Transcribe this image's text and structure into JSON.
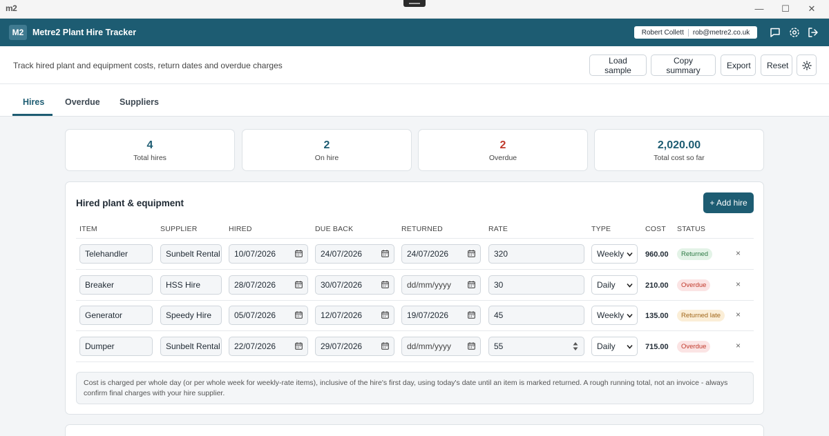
{
  "os": {
    "logo": "m2",
    "minimize": "—",
    "maximize": "☐",
    "close": "✕"
  },
  "header": {
    "logo": "M2",
    "title": "Metre2 Plant Hire Tracker",
    "user_name": "Robert Collett",
    "user_email": "rob@metre2.co.uk",
    "icons": [
      "chat-icon",
      "settings-icon",
      "logout-icon"
    ]
  },
  "toolbar": {
    "subtitle": "Track hired plant and equipment costs, return dates and overdue charges",
    "load_sample": "Load sample",
    "copy_summary": "Copy summary",
    "export": "Export",
    "reset": "Reset"
  },
  "tabs": [
    {
      "label": "Hires",
      "active": true
    },
    {
      "label": "Overdue",
      "active": false
    },
    {
      "label": "Suppliers",
      "active": false
    }
  ],
  "stats": [
    {
      "value": "4",
      "label": "Total hires"
    },
    {
      "value": "2",
      "label": "On hire"
    },
    {
      "value": "2",
      "label": "Overdue"
    },
    {
      "value": "2,020.00",
      "label": "Total cost so far"
    }
  ],
  "table": {
    "title": "Hired plant & equipment",
    "add_button": "+ Add hire",
    "columns": [
      "ITEM",
      "SUPPLIER",
      "HIRED",
      "DUE BACK",
      "RETURNED",
      "RATE",
      "TYPE",
      "COST",
      "STATUS"
    ],
    "rows": [
      {
        "item": "Telehandler",
        "supplier": "Sunbelt Rental",
        "hired": "10/07/2026",
        "due": "24/07/2026",
        "returned": "24/07/2026",
        "rate": "320",
        "type": "Weekly",
        "cost": "960.00",
        "status": "Returned"
      },
      {
        "item": "Breaker",
        "supplier": "HSS Hire",
        "hired": "28/07/2026",
        "due": "30/07/2026",
        "returned": "dd/mm/yyyy",
        "rate": "30",
        "type": "Daily",
        "cost": "210.00",
        "status": "Overdue"
      },
      {
        "item": "Generator",
        "supplier": "Speedy Hire",
        "hired": "05/07/2026",
        "due": "12/07/2026",
        "returned": "19/07/2026",
        "rate": "45",
        "type": "Weekly",
        "cost": "135.00",
        "status": "Returned late"
      },
      {
        "item": "Dumper",
        "supplier": "Sunbelt Rental",
        "hired": "22/07/2026",
        "due": "29/07/2026",
        "returned": "dd/mm/yyyy",
        "rate": "55",
        "type": "Daily",
        "cost": "715.00",
        "status": "Overdue"
      }
    ],
    "delete_symbol": "×",
    "note": "Cost is charged per whole day (or per whole week for weekly-rate items), inclusive of the hire's first day, using today's date until an item is marked returned. A rough running total, not an invoice - always confirm final charges with your hire supplier."
  },
  "colors": {
    "brand": "#1d5c72",
    "overdue": "#c0392b",
    "returned": "#2d7a45",
    "late": "#a0661a"
  }
}
